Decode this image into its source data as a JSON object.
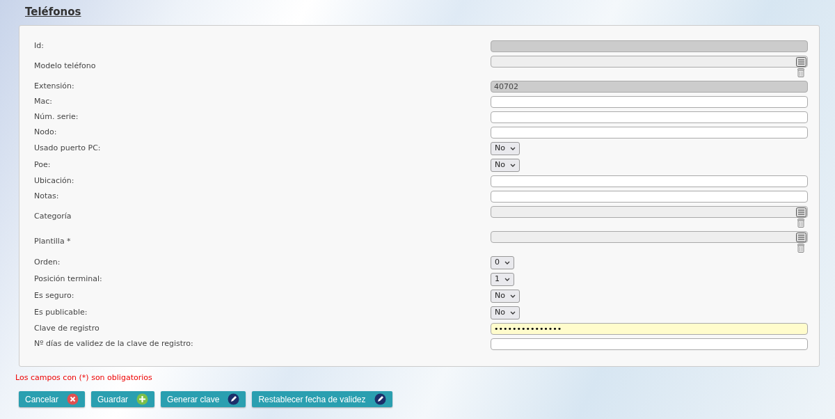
{
  "page_title": "Teléfonos",
  "fields": [
    {
      "label": "Id:",
      "kind": "text",
      "disabled": true
    },
    {
      "label": "Modelo teléfono",
      "kind": "lookup"
    },
    {
      "label": "Extensión:",
      "kind": "text",
      "disabled": true,
      "value": "40702"
    },
    {
      "label": "Mac:",
      "kind": "text",
      "disabled": false
    },
    {
      "label": "Núm. serie:",
      "kind": "text",
      "disabled": false
    },
    {
      "label": "Nodo:",
      "kind": "text",
      "disabled": false
    },
    {
      "label": "Usado puerto PC:",
      "kind": "select",
      "value": "No"
    },
    {
      "label": "Poe:",
      "kind": "select",
      "value": "No"
    },
    {
      "label": "Ubicación:",
      "kind": "text",
      "disabled": false
    },
    {
      "label": "Notas:",
      "kind": "text",
      "disabled": false
    },
    {
      "label": "Categoría",
      "kind": "lookup"
    },
    {
      "label": "Plantilla *",
      "kind": "lookup"
    },
    {
      "label": "Orden:",
      "kind": "select",
      "value": "0"
    },
    {
      "label": "Posición terminal:",
      "kind": "select",
      "value": "1"
    },
    {
      "label": "Es seguro:",
      "kind": "select",
      "value": "No"
    },
    {
      "label": "Es publicable:",
      "kind": "select",
      "value": "No"
    },
    {
      "label": "Clave de registro",
      "kind": "password",
      "value": "•••••••••••••••"
    },
    {
      "label": "Nº días de validez de la clave de registro:",
      "kind": "text",
      "disabled": false
    }
  ],
  "required_note": "Los campos con (*) son obligatorios",
  "buttons": [
    {
      "label": "Cancelar",
      "kind": "cancel"
    },
    {
      "label": "Guardar",
      "kind": "add"
    },
    {
      "label": "Generar clave",
      "kind": "edit"
    },
    {
      "label": "Restablecer fecha de validez",
      "kind": "edit"
    }
  ]
}
